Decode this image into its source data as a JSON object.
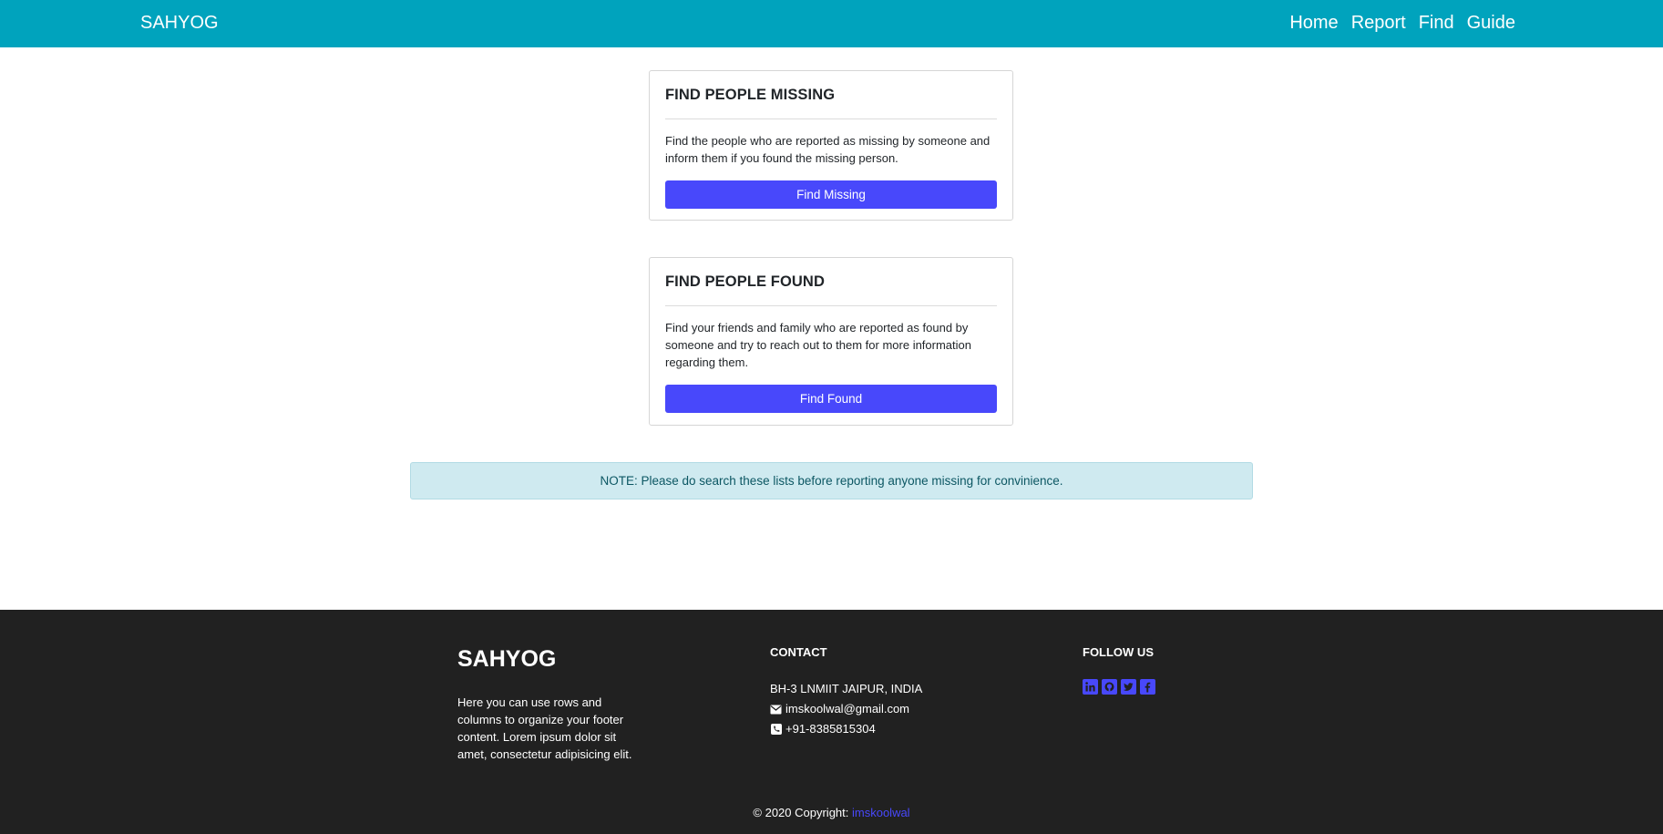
{
  "nav": {
    "brand": "SAHYOG",
    "links": [
      "Home",
      "Report",
      "Find",
      "Guide"
    ]
  },
  "cards": [
    {
      "title": "FIND PEOPLE MISSING",
      "text": "Find the people who are reported as missing by someone and inform them if you found the missing person.",
      "button": "Find Missing"
    },
    {
      "title": "FIND PEOPLE FOUND",
      "text": "Find your friends and family who are reported as found by someone and try to reach out to them for more information regarding them.",
      "button": "Find Found"
    }
  ],
  "note": "NOTE: Please do search these lists before reporting anyone missing for convinience.",
  "footer": {
    "brand": "SAHYOG",
    "description": "Here you can use rows and columns to organize your footer content. Lorem ipsum dolor sit amet, consectetur adipisicing elit.",
    "contact_heading": "CONTACT",
    "address": "BH-3 LNMIIT JAIPUR, INDIA",
    "email": "imskoolwal@gmail.com",
    "phone": "+91-8385815304",
    "follow_heading": "FOLLOW US",
    "social_icons": [
      "linkedin-icon",
      "github-icon",
      "twitter-icon",
      "facebook-icon"
    ],
    "copyright_text": "© 2020 Copyright: ",
    "copyright_link": "imskoolwal"
  },
  "colors": {
    "navbar": "#00a3bd",
    "button": "#4848fb",
    "footer": "#212121",
    "note_bg": "#cfeaf0"
  }
}
